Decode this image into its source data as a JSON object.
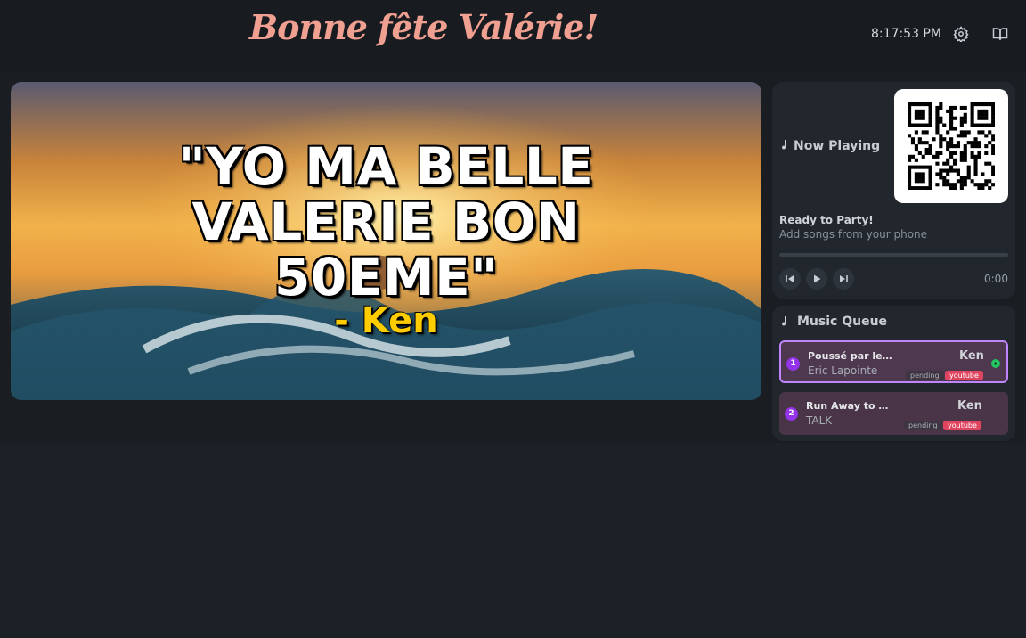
{
  "header": {
    "title": "Bonne fête Valérie!",
    "clock": "8:17:53 PM",
    "settings_icon": "gear-icon",
    "guide_icon": "book-open-icon"
  },
  "hero": {
    "quote": "\"YO MA BELLE VALERIE BON 50EME\"",
    "author": "- Ken",
    "accent_color": "#ffcc00"
  },
  "now_playing": {
    "heading": "Now Playing",
    "status_title": "Ready to Party!",
    "status_subtitle": "Add songs from your phone",
    "progress": 0,
    "time": "0:00"
  },
  "queue": {
    "heading": "Music Queue",
    "items": [
      {
        "index": "1",
        "title": "Poussé par le ...",
        "artist": "Eric Lapointe",
        "requested_by": "Ken",
        "status": "pending",
        "source": "youtube"
      },
      {
        "index": "2",
        "title": "Run Away to M...",
        "artist": "TALK",
        "requested_by": "Ken",
        "status": "pending",
        "source": "youtube"
      }
    ]
  },
  "colors": {
    "background": "#1a1e23",
    "panel": "#22272e",
    "title": "#f0a090",
    "queue_accent": "#9333ea",
    "source_badge": "#e04560",
    "play_indicator": "#22c55e"
  }
}
